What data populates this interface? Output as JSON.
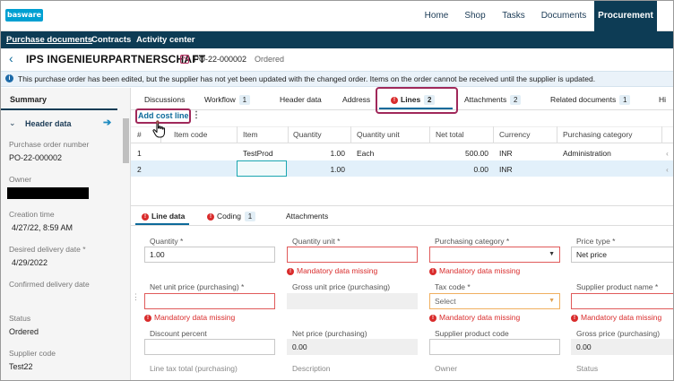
{
  "app": {
    "logo": "basware"
  },
  "topnav": {
    "home": "Home",
    "shop": "Shop",
    "tasks": "Tasks",
    "documents": "Documents",
    "procurement": "Procurement"
  },
  "subnav": {
    "purchase_documents": "Purchase documents",
    "contracts": "Contracts",
    "activity_center": "Activity center"
  },
  "header": {
    "title": "IPS INGENIEURPARTNERSCHAFT",
    "po_number": "PO-22-000002",
    "status": "Ordered"
  },
  "info": {
    "text": "This purchase order has been edited, but the supplier has not yet been updated with the changed order. Items on the order cannot be received until the supplier is updated."
  },
  "summary": {
    "title": "Summary",
    "section": "Header data",
    "fields": [
      {
        "label": "Purchase order number",
        "value": "PO-22-000002"
      },
      {
        "label": "Owner",
        "value": ""
      },
      {
        "label": "Creation time",
        "value": "4/27/22, 8:59 AM"
      },
      {
        "label": "Desired delivery date *",
        "value": "4/29/2022"
      },
      {
        "label": "Confirmed delivery date",
        "value": ""
      },
      {
        "label": "Status",
        "value": "Ordered"
      },
      {
        "label": "Supplier code",
        "value": "Test22"
      }
    ]
  },
  "tabs": [
    {
      "label": "Discussions",
      "count": ""
    },
    {
      "label": "Workflow",
      "count": "1"
    },
    {
      "label": "Header data",
      "count": ""
    },
    {
      "label": "Address",
      "count": ""
    },
    {
      "label": "Lines",
      "count": "2"
    },
    {
      "label": "Attachments",
      "count": "2"
    },
    {
      "label": "Related documents",
      "count": "1"
    },
    {
      "label": "Hi",
      "count": ""
    }
  ],
  "actions": {
    "add_cost_line": "Add cost line",
    "more": "⋮"
  },
  "grid": {
    "columns": [
      "#",
      "Item code",
      "Item",
      "Quantity",
      "Quantity unit",
      "Net total",
      "Currency",
      "Purchasing category",
      ""
    ],
    "rows": [
      {
        "num": "1",
        "item_code": "",
        "item": "TestProd",
        "quantity": "1.00",
        "unit": "Each",
        "net_total": "500.00",
        "currency": "INR",
        "category": "Administration",
        "extra": "‹"
      },
      {
        "num": "2",
        "item_code": "",
        "item": "",
        "quantity": "1.00",
        "unit": "",
        "net_total": "0.00",
        "currency": "INR",
        "category": "",
        "extra": "‹"
      }
    ]
  },
  "bottom_tabs": [
    {
      "label": "Line data",
      "count": ""
    },
    {
      "label": "Coding",
      "count": "1"
    },
    {
      "label": "Attachments",
      "count": ""
    }
  ],
  "form": {
    "quantity": {
      "label": "Quantity *",
      "value": "1.00"
    },
    "quantity_unit": {
      "label": "Quantity unit *",
      "value": "",
      "error": "Mandatory data missing"
    },
    "purchasing_category": {
      "label": "Purchasing category *",
      "value": "",
      "error": "Mandatory data missing"
    },
    "price_type": {
      "label": "Price type *",
      "value": "Net price"
    },
    "net_unit_price": {
      "label": "Net unit price (purchasing) *",
      "value": "",
      "error": "Mandatory data missing"
    },
    "gross_unit_price": {
      "label": "Gross unit price (purchasing)",
      "value": ""
    },
    "tax_code": {
      "label": "Tax code *",
      "placeholder": "Select",
      "error": "Mandatory data missing"
    },
    "supplier_product_name": {
      "label": "Supplier product name *",
      "value": "",
      "error": "Mandatory data missing"
    },
    "discount_percent": {
      "label": "Discount percent",
      "value": ""
    },
    "net_price": {
      "label": "Net price (purchasing)",
      "value": "0.00"
    },
    "supplier_product_code": {
      "label": "Supplier product code",
      "value": ""
    },
    "gross_price": {
      "label": "Gross price (purchasing)",
      "value": "0.00"
    },
    "line_tax_total": {
      "label": "Line tax total (purchasing)"
    },
    "description": {
      "label": "Description"
    },
    "owner": {
      "label": "Owner"
    },
    "status": {
      "label": "Status"
    }
  },
  "icons": {
    "back": "chevron-left-icon",
    "error": "error-icon",
    "info": "info-icon",
    "expand_arrow": "arrow-right-icon",
    "cursor": "hand-pointer-icon"
  },
  "colors": {
    "brand": "#0d3c55",
    "accent": "#0d6a9a",
    "error": "#d92c2c",
    "highlight": "#a0285a"
  }
}
